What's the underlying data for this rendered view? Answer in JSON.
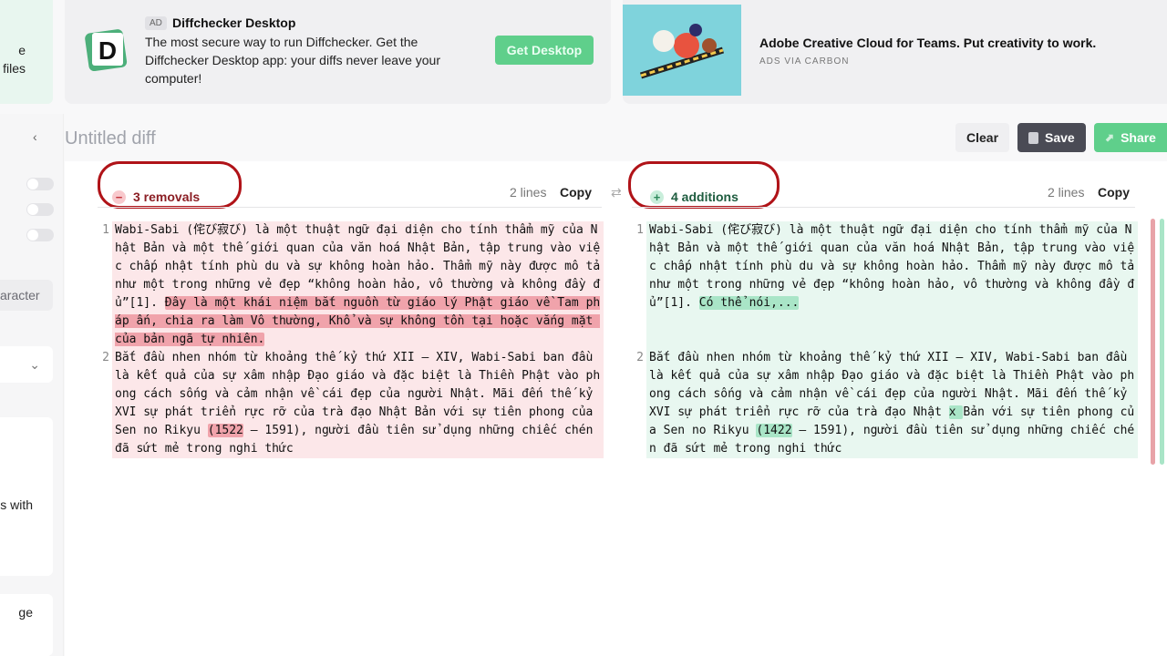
{
  "sidebar": {
    "promo_lines": [
      "e",
      "files"
    ],
    "toggles": [
      false,
      false,
      false
    ],
    "chip": "aracter",
    "card1": "s with",
    "card2": "ge"
  },
  "ad1": {
    "tag": "AD",
    "title": "Diffchecker Desktop",
    "desc": "The most secure way to run Diffchecker. Get the Diffchecker Desktop app: your diffs never leave your computer!",
    "button": "Get Desktop",
    "logo_letter": "D"
  },
  "ad2": {
    "title": "Adobe Creative Cloud for Teams. Put creativity to work.",
    "sub": "ADS VIA CARBON"
  },
  "header": {
    "title": "Untitled diff",
    "clear": "Clear",
    "save": "Save",
    "share": "Share"
  },
  "left": {
    "count": "3 removals",
    "lines": "2 lines",
    "copy": "Copy",
    "rows": [
      {
        "n": "1",
        "segs": [
          {
            "t": "Wabi-Sabi (侘び寂び) là một thuật ngữ đại diện cho tính thẩm mỹ của Nhật Bản và một thế giới quan của văn hoá Nhật Bản, tập trung vào việc chấp nhật tính phù du và sự không hoàn hảo. Thẩm mỹ này được mô tả như một trong những vẻ đẹp “không hoàn hảo, vô thường và không đầy đủ”[1]. "
          },
          {
            "t": "Đây là một khái niệm bắt nguồn từ giáo lý Phật giáo về Tam pháp ấn, chia ra làm Vô thường, Khổ và sự không tồn tại hoặc vắng mặt của bản ngã tự nhiên.",
            "h": true
          }
        ]
      },
      {
        "n": "2",
        "segs": [
          {
            "t": "Bắt đầu nhen nhóm từ khoảng thế kỷ thứ XII – XIV, Wabi-Sabi ban đầu là kết quả của sự xâm nhập Đạo giáo và đặc biệt là Thiền Phật vào phong cách sống và cảm nhận về cái đẹp của người Nhật. Mãi đến thế kỷ XVI sự phát triển rực rỡ của trà đạo Nhật Bản với sự tiên phong của Sen no Rikyu "
          },
          {
            "t": "(1522",
            "h": true
          },
          {
            "t": " – 1591), người đầu tiên sử dụng những chiếc chén đã sứt mẻ trong nghi thức"
          }
        ]
      }
    ]
  },
  "right": {
    "count": "4 additions",
    "lines": "2 lines",
    "copy": "Copy",
    "rows": [
      {
        "n": "1",
        "segs": [
          {
            "t": "Wabi-Sabi (侘び寂び) là một thuật ngữ đại diện cho tính thẩm mỹ của Nhật Bản và một thế giới quan của văn hoá Nhật Bản, tập trung vào việc chấp nhật tính phù du và sự không hoàn hảo. Thẩm mỹ này được mô tả như một trong những vẻ đẹp “không hoàn hảo, vô thường và không đầy đủ”[1]. "
          },
          {
            "t": "Có thể nói,...",
            "h": true
          }
        ]
      },
      {
        "n": "2",
        "segs": [
          {
            "t": "Bắt đầu nhen nhóm từ khoảng thế kỷ thứ XII – XIV, Wabi-Sabi ban đầu là kết quả của sự xâm nhập Đạo giáo và đặc biệt là Thiền Phật vào phong cách sống và cảm nhận về cái đẹp của người Nhật. Mãi đến thế kỷ XVI sự phát triển rực rỡ của trà đạo Nhật "
          },
          {
            "t": "x ",
            "h": true
          },
          {
            "t": "Bản với sự tiên phong của Sen no Rikyu "
          },
          {
            "t": "(1422",
            "h": true
          },
          {
            "t": " – 1591), người đầu tiên sử dụng những chiếc chén đã sứt mẻ trong nghi thức"
          }
        ]
      }
    ]
  },
  "colors": {
    "removed_bg": "#fce7e9",
    "removed_hl": "#f0a3ab",
    "added_bg": "#e8f7f0",
    "added_hl": "#a9e5c7",
    "annotation": "#b01318",
    "accent": "#5fcf8b"
  }
}
